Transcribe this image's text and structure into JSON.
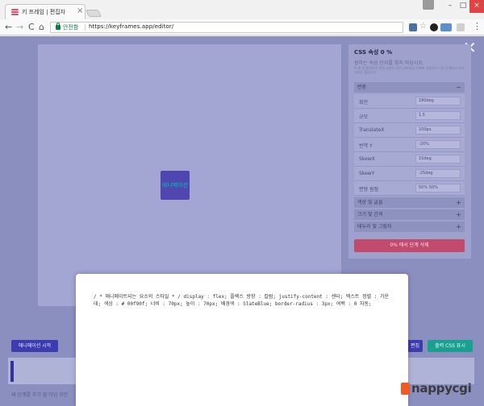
{
  "browser": {
    "tab_title": "키 프레임 | 편집자",
    "tab_close": "×",
    "window_buttons": [
      "–",
      "□",
      "×"
    ],
    "nav": {
      "back": "←",
      "forward": "→",
      "reload": "C",
      "home": "⌂"
    },
    "secure_label": "안전함",
    "url_separator": "|",
    "url": "https://keyframes.app/editor/",
    "menu": "⋮"
  },
  "editor": {
    "close": "✕",
    "anim_box_text": "애니메이션",
    "panel": {
      "title": "CSS 속성 0 %",
      "subtitle": "원하는 속성 단위를 찾지 마십시오.",
      "hint": "※ 한 번 편집하면 변경 사항은 모든 키프레임 단계에 적용되어 다른 단계에서 유지되지는 않습니다.",
      "section_transform": {
        "label": "변환",
        "sign": "−"
      },
      "properties": [
        {
          "label": "회전",
          "value": "180deg"
        },
        {
          "label": "규모",
          "value": "1.5"
        },
        {
          "label": "TranslateX",
          "value": "100px"
        },
        {
          "label": "번역 Y",
          "value": "-20%"
        },
        {
          "label": "SkewX",
          "value": "15deg"
        },
        {
          "label": "SkewY",
          "value": "-25deg"
        },
        {
          "label": "변형 원점",
          "value": "50% 50%"
        }
      ],
      "collapsed_sections": [
        {
          "label": "색상 및 글꼴",
          "sign": "+"
        },
        {
          "label": "크기 및 간격",
          "sign": "+"
        },
        {
          "label": "테두리 및 그림자",
          "sign": "+"
        }
      ],
      "delete_button": "0% 에서 단계 삭제"
    },
    "bottom": {
      "start_button": "애니메이션 시작",
      "partial_button": "편집",
      "css_button": "출력 CSS 표시",
      "timeline_hint": "새 단계를 추가 할 타임 라인"
    }
  },
  "modal": {
    "code": "/ * 애니메이트되는 요소의 스타일 * / display : flex; 플렉스 방향 : 칼럼; justify-content : 센터; 텍스트 정렬 : 가운데; 색상 : # 00f90f; 너비 : 70px; 높이 : 70px; 배경색 : SlateBlue; border-radius : 3px; 여백 : 0 자동;"
  },
  "watermark": "nappycgi",
  "colors": {
    "overlay": "#8b8fc0",
    "anim_box": "#4f46b0",
    "delete": "#c24a6f",
    "css_button": "#1aa08f",
    "primary_button": "#3c3cae"
  }
}
